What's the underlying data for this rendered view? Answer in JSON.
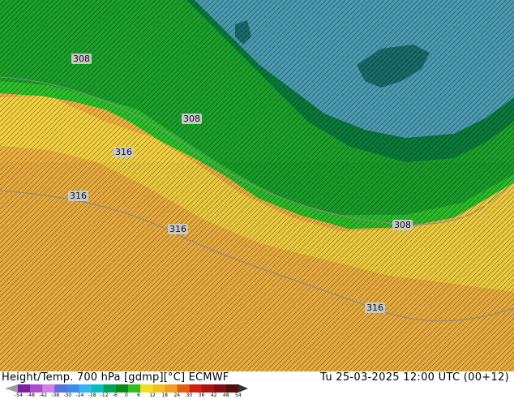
{
  "footer": {
    "title": "Height/Temp. 700 hPa [gdmp][°C] ECMWF",
    "datetime": "Tu 25-03-2025 12:00 UTC (00+12)"
  },
  "contour_labels": [
    "308",
    "308",
    "316",
    "316",
    "316",
    "308",
    "316"
  ],
  "colorbar": {
    "ticks": [
      "-54",
      "-48",
      "-42",
      "-38",
      "-30",
      "-24",
      "-18",
      "-12",
      "-6",
      "0",
      "6",
      "12",
      "18",
      "24",
      "30",
      "36",
      "42",
      "48",
      "54"
    ],
    "colors": [
      "#7a1fa0",
      "#b04cd0",
      "#d27fe6",
      "#5a6fd8",
      "#3a8ce8",
      "#34b6f0",
      "#00c0c0",
      "#00a060",
      "#0a8a1a",
      "#30c020",
      "#f0e020",
      "#f0c020",
      "#f0a020",
      "#e06010",
      "#d02010",
      "#b01010",
      "#801010",
      "#501010"
    ]
  },
  "map_colors": {
    "cold_blue": "#4aa0b8",
    "dark_green": "#0a6a30",
    "green": "#12a020",
    "bright_green": "#40c030",
    "yellow": "#f0d040",
    "orange": "#f0b040"
  }
}
